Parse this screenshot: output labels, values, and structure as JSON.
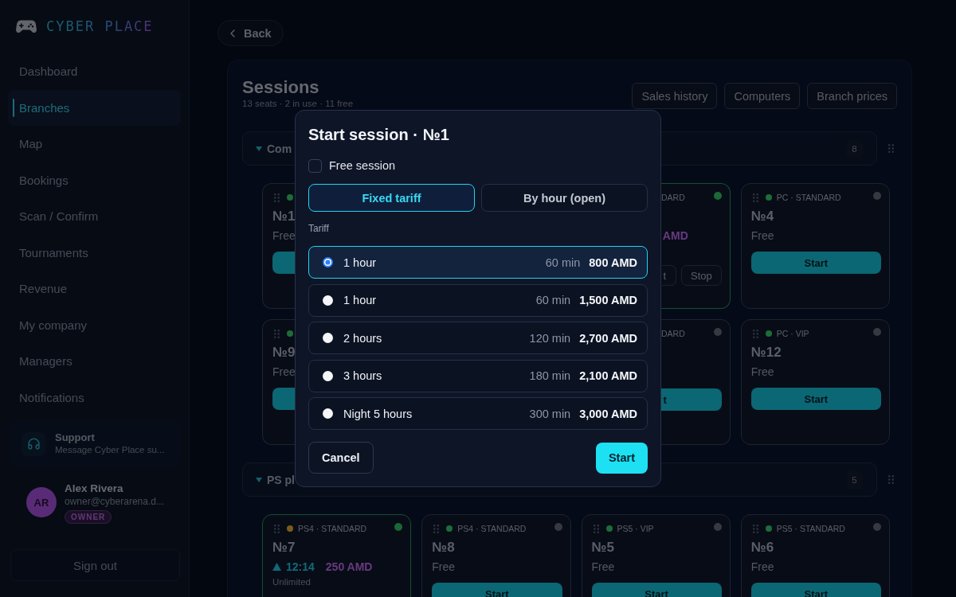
{
  "sidebar": {
    "logo": "CYBER PLACE",
    "nav": [
      {
        "label": "Dashboard",
        "selected": false
      },
      {
        "label": "Branches",
        "selected": true
      },
      {
        "label": "Map",
        "selected": false
      },
      {
        "label": "Bookings",
        "selected": false
      },
      {
        "label": "Scan / Confirm",
        "selected": false
      },
      {
        "label": "Tournaments",
        "selected": false
      },
      {
        "label": "Revenue",
        "selected": false
      },
      {
        "label": "My company",
        "selected": false
      },
      {
        "label": "Managers",
        "selected": false
      },
      {
        "label": "Notifications",
        "selected": false
      }
    ],
    "support": {
      "title": "Support",
      "subtitle": "Message Cyber Place su..."
    },
    "user": {
      "initials": "AR",
      "name": "Alex Rivera",
      "email": "owner@cyberarena.d...",
      "role": "OWNER"
    },
    "sign_out": "Sign out"
  },
  "main": {
    "back": "Back",
    "title": "Sessions",
    "summary": "13 seats · 2 in use · 11 free",
    "actions": [
      "Sales history",
      "Computers",
      "Branch prices"
    ],
    "groups": [
      {
        "title": "Com",
        "count": "8",
        "expanded": true,
        "cards": [
          {
            "kind": "leading",
            "color": "#1e6c38",
            "number": "№1",
            "status": "Free"
          },
          {
            "kind": "trailing",
            "type": "DARD",
            "active": true,
            "price": "AMD",
            "actions": [
              "t",
              "Stop"
            ]
          },
          {
            "kind": "free",
            "color": "#1e6c38",
            "type": "PC · STANDARD",
            "active": false,
            "number": "№4",
            "status": "Free",
            "button": "Start"
          },
          {
            "kind": "leading",
            "color": "#1e6c38",
            "number": "№9",
            "status": "Free"
          },
          {
            "kind": "trailing",
            "type": "DARD",
            "active": false,
            "button": "t"
          },
          {
            "kind": "free",
            "color": "#1e6c38",
            "type": "PC · VIP",
            "active": false,
            "number": "№12",
            "status": "Free",
            "button": "Start"
          }
        ]
      },
      {
        "title": "PS pl",
        "count": "5",
        "expanded": true,
        "cards": [
          {
            "kind": "session",
            "color": "#7c5a1c",
            "type": "PS4 · STANDARD",
            "active": true,
            "number": "№7",
            "time": "12:14",
            "price": "250 AMD",
            "limit": "Unlimited"
          },
          {
            "kind": "free",
            "color": "#1e6c38",
            "type": "PS4 · STANDARD",
            "active": false,
            "number": "№8",
            "status": "Free",
            "button": "Start"
          },
          {
            "kind": "free",
            "color": "#1e6c38",
            "type": "PS5 · VIP",
            "active": false,
            "number": "№5",
            "status": "Free",
            "button": "Start"
          },
          {
            "kind": "free",
            "color": "#1e6c38",
            "type": "PS5 · STANDARD",
            "active": false,
            "number": "№6",
            "status": "Free",
            "button": "Start"
          }
        ]
      }
    ]
  },
  "modal": {
    "title": "Start session · №1",
    "free_session": {
      "label": "Free session",
      "checked": false
    },
    "modes": [
      {
        "label": "Fixed tariff",
        "selected": true
      },
      {
        "label": "By hour (open)",
        "selected": false
      }
    ],
    "tariff_label": "Tariff",
    "tariffs": [
      {
        "name": "1 hour",
        "duration": "60 min",
        "price": "800 AMD",
        "selected": true
      },
      {
        "name": "1 hour",
        "duration": "60 min",
        "price": "1,500 AMD",
        "selected": false
      },
      {
        "name": "2 hours",
        "duration": "120 min",
        "price": "2,700 AMD",
        "selected": false
      },
      {
        "name": "3 hours",
        "duration": "180 min",
        "price": "2,100 AMD",
        "selected": false
      },
      {
        "name": "Night 5 hours",
        "duration": "300 min",
        "price": "3,000 AMD",
        "selected": false
      }
    ],
    "cancel": "Cancel",
    "submit": "Start"
  }
}
